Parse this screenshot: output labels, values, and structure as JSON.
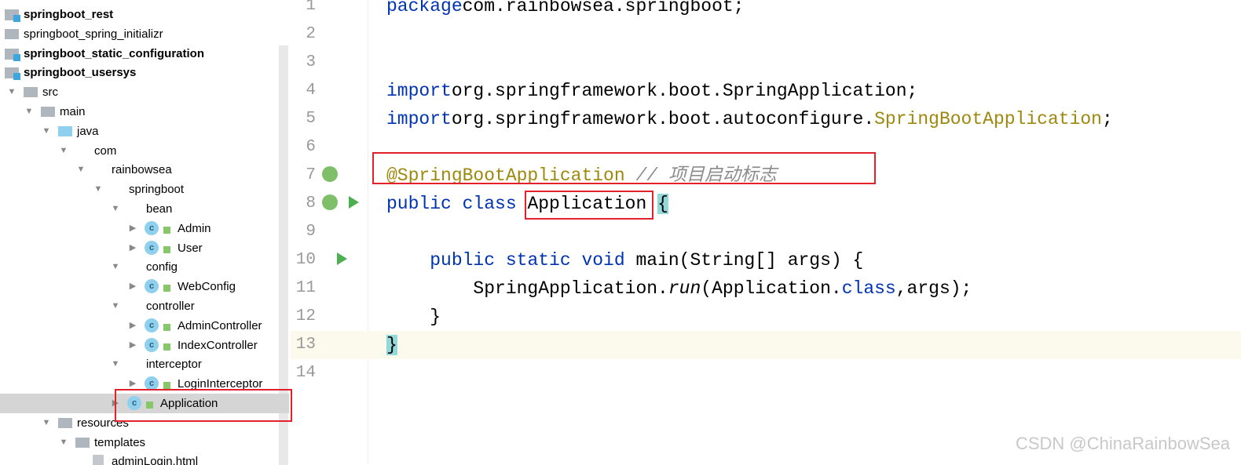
{
  "tree": {
    "items": [
      {
        "label": "springboot_rest",
        "bold": true,
        "icon": "module-icon",
        "depth": 0
      },
      {
        "label": "springboot_spring_initializr",
        "bold": false,
        "icon": "folder-icon",
        "depth": 0
      },
      {
        "label": "springboot_static_configuration",
        "bold": true,
        "icon": "module-icon",
        "depth": 0
      },
      {
        "label": "springboot_usersys",
        "bold": true,
        "icon": "module-icon",
        "depth": 0
      },
      {
        "label": "src",
        "icon": "folder-icon",
        "depth": 0,
        "expanded": true
      },
      {
        "label": "main",
        "icon": "folder-icon",
        "depth": 1,
        "expanded": true
      },
      {
        "label": "java",
        "icon": "source-folder-icon",
        "depth": 2,
        "expanded": true
      },
      {
        "label": "com",
        "icon": "package-icon",
        "depth": 3,
        "expanded": true
      },
      {
        "label": "rainbowsea",
        "icon": "package-icon",
        "depth": 4,
        "expanded": true
      },
      {
        "label": "springboot",
        "icon": "package-icon",
        "depth": 5,
        "expanded": true
      },
      {
        "label": "bean",
        "icon": "package-icon",
        "depth": 6,
        "expanded": true
      },
      {
        "label": "Admin",
        "icon": "class-icon",
        "depth": 7
      },
      {
        "label": "User",
        "icon": "class-icon",
        "depth": 7
      },
      {
        "label": "config",
        "icon": "package-icon",
        "depth": 6,
        "expanded": true
      },
      {
        "label": "WebConfig",
        "icon": "class-icon",
        "depth": 7
      },
      {
        "label": "controller",
        "icon": "package-icon",
        "depth": 6,
        "expanded": true
      },
      {
        "label": "AdminController",
        "icon": "class-icon",
        "depth": 7
      },
      {
        "label": "IndexController",
        "icon": "class-icon",
        "depth": 7
      },
      {
        "label": "interceptor",
        "icon": "package-icon",
        "depth": 6,
        "expanded": true
      },
      {
        "label": "LoginInterceptor",
        "icon": "class-icon",
        "depth": 7
      },
      {
        "label": "Application",
        "icon": "spring-boot-class-icon",
        "depth": 6,
        "selected": true
      },
      {
        "label": "resources",
        "icon": "resources-folder-icon",
        "depth": 2,
        "expanded": true
      },
      {
        "label": "templates",
        "icon": "folder-icon",
        "depth": 3,
        "expanded": true
      },
      {
        "label": "adminLogin.html",
        "icon": "html-file-icon",
        "depth": 4
      }
    ]
  },
  "editor": {
    "lines": [
      {
        "n": "1",
        "tokens": [
          [
            "kw",
            "package"
          ],
          [
            "",
            "com.rainbowsea.springboot;"
          ]
        ]
      },
      {
        "n": "2",
        "tokens": []
      },
      {
        "n": "3",
        "tokens": []
      },
      {
        "n": "4",
        "tokens": [
          [
            "kw",
            "import"
          ],
          [
            "",
            "org.springframework.boot.SpringApplication;"
          ]
        ]
      },
      {
        "n": "5",
        "tokens": [
          [
            "kw",
            "import"
          ],
          [
            "",
            "org.springframework.boot.autoconfigure."
          ],
          [
            "ann",
            "SpringBootApplication"
          ],
          [
            "",
            ";"
          ]
        ]
      },
      {
        "n": "6",
        "tokens": []
      },
      {
        "n": "7",
        "tokens": [
          [
            "ann",
            "@SpringBootApplication"
          ],
          [
            "cm",
            " // 项目启动标志"
          ]
        ]
      },
      {
        "n": "8",
        "tokens": [
          [
            "kw",
            "public class "
          ],
          [
            "",
            "Application"
          ],
          [
            "",
            " "
          ],
          [
            "cyan",
            "{"
          ]
        ]
      },
      {
        "n": "9",
        "tokens": []
      },
      {
        "n": "10",
        "tokens": [
          [
            "",
            "    "
          ],
          [
            "kw",
            "public static void "
          ],
          [
            "",
            "main(String[] args) {"
          ]
        ]
      },
      {
        "n": "11",
        "tokens": [
          [
            "",
            "        SpringApplication."
          ],
          [
            "it",
            "run"
          ],
          [
            "",
            "(Application."
          ],
          [
            "kw",
            "class"
          ],
          [
            "",
            ",args);"
          ]
        ]
      },
      {
        "n": "12",
        "tokens": [
          [
            "",
            "    }"
          ]
        ]
      },
      {
        "n": "13",
        "tokens": [
          [
            "cyan",
            "}"
          ]
        ],
        "current": true
      },
      {
        "n": "14",
        "tokens": []
      }
    ]
  },
  "watermark": "CSDN @ChinaRainbowSea"
}
